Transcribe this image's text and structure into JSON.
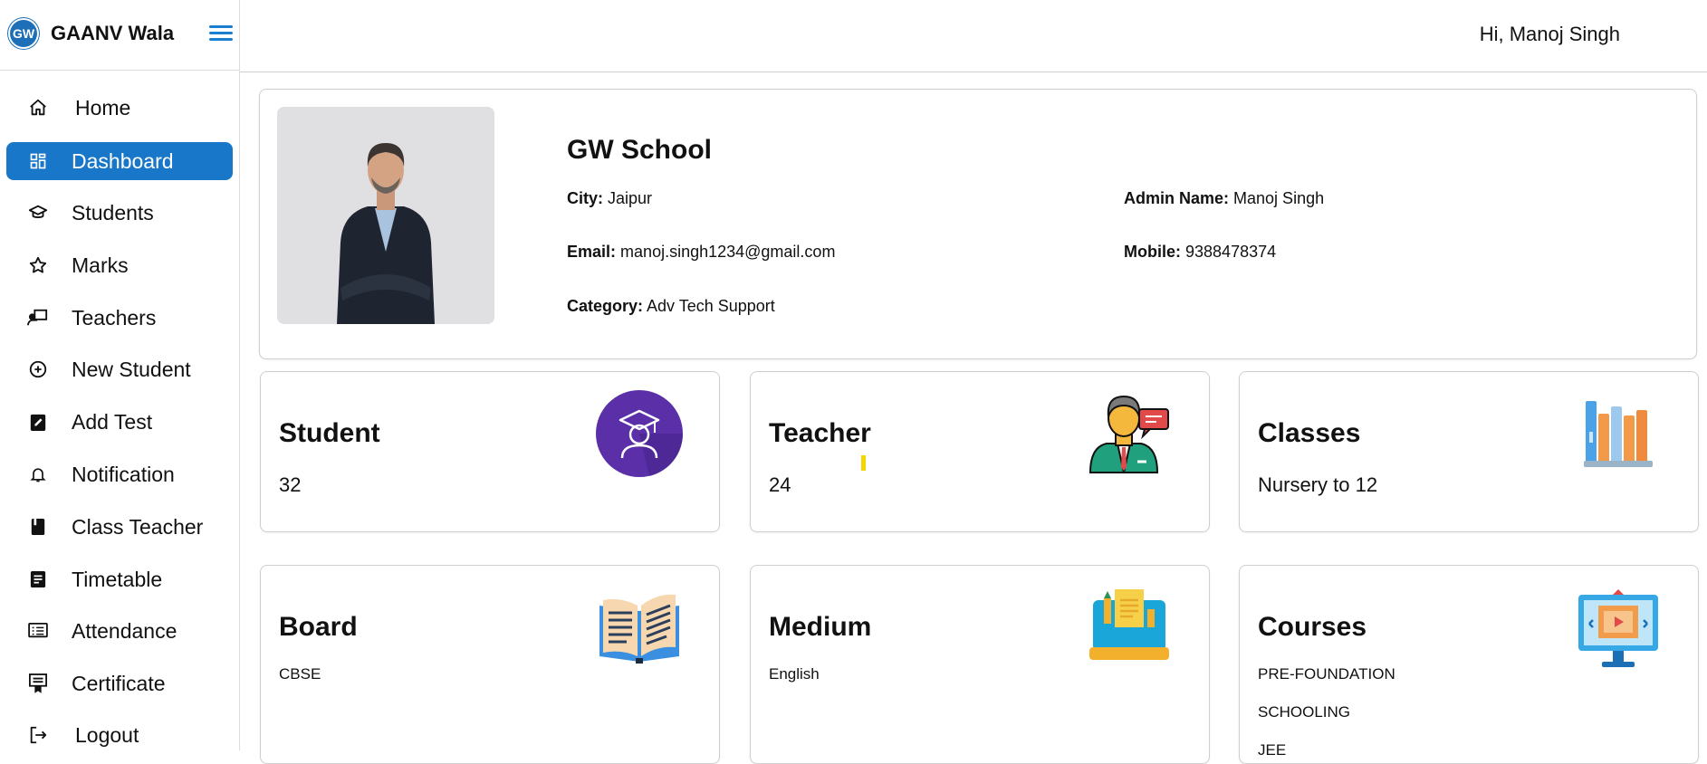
{
  "app": {
    "brand": "GAANV Wala",
    "logo_text": "GW"
  },
  "header": {
    "greeting": "Hi, Manoj Singh"
  },
  "sidebar": {
    "items": [
      {
        "label": "Home",
        "icon": "home-icon"
      },
      {
        "label": "Dashboard",
        "icon": "dashboard-icon",
        "active": true
      },
      {
        "label": "Students",
        "icon": "graduation-cap-icon"
      },
      {
        "label": "Marks",
        "icon": "star-icon"
      },
      {
        "label": "Teachers",
        "icon": "teacher-board-icon"
      },
      {
        "label": "New Student",
        "icon": "plus-circle-icon"
      },
      {
        "label": "Add Test",
        "icon": "clipboard-edit-icon"
      },
      {
        "label": "Notification",
        "icon": "bell-icon"
      },
      {
        "label": "Class Teacher",
        "icon": "book-icon"
      },
      {
        "label": "Timetable",
        "icon": "document-icon"
      },
      {
        "label": "Attendance",
        "icon": "list-icon"
      },
      {
        "label": "Certificate",
        "icon": "certificate-icon"
      },
      {
        "label": "Logout",
        "icon": "logout-icon"
      }
    ]
  },
  "profile": {
    "school_name": "GW School",
    "city_label": "City:",
    "city": "Jaipur",
    "admin_label": "Admin Name:",
    "admin": "Manoj Singh",
    "email_label": "Email:",
    "email": "manoj.singh1234@gmail.com",
    "mobile_label": "Mobile:",
    "mobile": "9388478374",
    "category_label": "Category:",
    "category": "Adv Tech Support"
  },
  "stats": [
    {
      "title": "Student",
      "value": "32",
      "icon": "student-icon"
    },
    {
      "title": "Teacher",
      "value": "24",
      "icon": "teacher-icon"
    },
    {
      "title": "Classes",
      "value": "Nursery to 12",
      "icon": "books-icon"
    },
    {
      "title": "Board",
      "value": "CBSE",
      "icon": "open-book-icon"
    },
    {
      "title": "Medium",
      "value": "English",
      "icon": "laptop-document-icon"
    },
    {
      "title": "Courses",
      "values": [
        "PRE-FOUNDATION",
        "SCHOOLING",
        "JEE"
      ],
      "icon": "monitor-video-icon"
    }
  ],
  "colors": {
    "accent": "#1977c9",
    "student_icon_bg": "#5b2fa8"
  }
}
